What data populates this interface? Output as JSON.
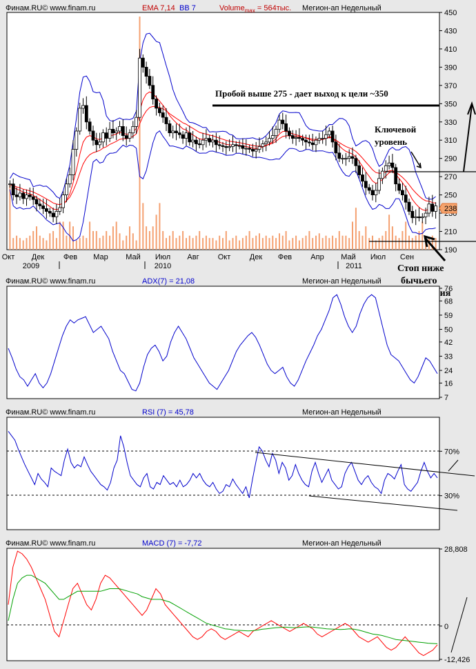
{
  "panels": {
    "price": {
      "header": {
        "source": "Финам.RU© www.finam.ru",
        "ema": "EMA 7,14",
        "bb": "BB 7",
        "volume": "Volume",
        "volume_sub": "max",
        "volume_val": " = 564тыс.",
        "instrument": "Мегион-ап Недельный"
      },
      "y_ticks": [
        "450",
        "430",
        "410",
        "390",
        "370",
        "350",
        "330",
        "310",
        "290",
        "270",
        "250",
        "230",
        "210",
        "190"
      ],
      "y_range": [
        190,
        450
      ],
      "last_price": "238",
      "x_ticks": [
        "Окт",
        "Дек",
        "Фев",
        "Мар",
        "Май",
        "Июл",
        "Авг",
        "Окт",
        "Дек",
        "Фев",
        "Апр",
        "Май",
        "Июл",
        "Сен"
      ],
      "year_labels": [
        "2009",
        "2010",
        "2011"
      ],
      "annotations": {
        "breakout": "Пробой выше 275 - дает выход к цели ~350",
        "key_level_1": "Ключевой",
        "key_level_2": "уровень",
        "stop_1": "Стоп ниже",
        "stop_2": "бычьего",
        "stop_3": "поглощения"
      }
    },
    "adx": {
      "header": {
        "source": "Финам.RU© www.finam.ru",
        "indicator": "ADX(7) = 21,08",
        "instrument": "Мегион-ап Недельный"
      },
      "y_ticks": [
        "76",
        "68",
        "59",
        "50",
        "42",
        "33",
        "24",
        "16",
        "7"
      ],
      "y_range": [
        7,
        76
      ]
    },
    "rsi": {
      "header": {
        "source": "Финам.RU© www.finam.ru",
        "indicator": "RSI (7) = 45,78",
        "instrument": "Мегион-ап Недельный"
      },
      "y_ticks": [
        "70%",
        "30%"
      ],
      "y_range": [
        0,
        100
      ]
    },
    "macd": {
      "header": {
        "source": "Финам.RU© www.finam.ru",
        "indicator": "MACD (7) = -7,72",
        "instrument": "Мегион-ап Недельный"
      },
      "y_ticks": [
        "28,808",
        "0",
        "-12,426"
      ],
      "y_range": [
        -12.426,
        28.808
      ]
    }
  },
  "colors": {
    "candle": "#000000",
    "ema": "#ff0000",
    "bb": "#0000cc",
    "volume": "#f4a070",
    "adx": "#0000cc",
    "rsi": "#0000cc",
    "macd": "#ff0000",
    "signal": "#00a000"
  },
  "chart_data": [
    {
      "type": "candlestick",
      "panel": "price",
      "ylim": [
        190,
        450
      ],
      "x_count": 107,
      "close": [
        262,
        250,
        248,
        252,
        246,
        250,
        248,
        245,
        240,
        238,
        235,
        232,
        230,
        226,
        232,
        236,
        250,
        262,
        272,
        300,
        320,
        345,
        348,
        330,
        320,
        310,
        305,
        308,
        318,
        312,
        322,
        318,
        320,
        325,
        315,
        312,
        318,
        325,
        335,
        400,
        390,
        380,
        370,
        355,
        345,
        340,
        335,
        328,
        318,
        320,
        318,
        316,
        312,
        318,
        308,
        310,
        306,
        305,
        310,
        312,
        308,
        310,
        305,
        304,
        303,
        302,
        303,
        305,
        304,
        304,
        301,
        301,
        300,
        298,
        300,
        303,
        306,
        308,
        312,
        315,
        322,
        332,
        328,
        320,
        315,
        312,
        313,
        312,
        310,
        308,
        307,
        305,
        310,
        312,
        312,
        316,
        320,
        308,
        296,
        290,
        290,
        290,
        292,
        290,
        282,
        272,
        265,
        258,
        255,
        250,
        255,
        268,
        276,
        282,
        285,
        280,
        262,
        255,
        250,
        242,
        232,
        225,
        226,
        225,
        226,
        230,
        240,
        232,
        238
      ],
      "volume": [
        0.28,
        0.05,
        0.06,
        0.05,
        0.04,
        0.05,
        0.06,
        0.08,
        0.1,
        0.06,
        0.05,
        0.04,
        0.07,
        0.08,
        0.05,
        0.12,
        0.12,
        0.06,
        0.12,
        0.1,
        0.04,
        0.05,
        0.06,
        0.05,
        0.12,
        0.08,
        0.08,
        0.05,
        0.06,
        0.08,
        0.06,
        0.1,
        0.12,
        0.07,
        0.04,
        0.06,
        0.1,
        0.07,
        0.04,
        1.0,
        0.2,
        0.1,
        0.08,
        0.1,
        0.15,
        0.2,
        0.08,
        0.05,
        0.06,
        0.08,
        0.05,
        0.06,
        0.08,
        0.05,
        0.06,
        0.05,
        0.06,
        0.08,
        0.05,
        0.06,
        0.05,
        0.05,
        0.04,
        0.06,
        0.05,
        0.08,
        0.04,
        0.05,
        0.06,
        0.04,
        0.05,
        0.06,
        0.08,
        0.05,
        0.06,
        0.07,
        0.05,
        0.06,
        0.05,
        0.06,
        0.05,
        0.07,
        0.06,
        0.08,
        0.04,
        0.05,
        0.06,
        0.04,
        0.05,
        0.06,
        0.08,
        0.05,
        0.06,
        0.07,
        0.05,
        0.06,
        0.05,
        0.06,
        0.05,
        0.08,
        0.06,
        0.06,
        0.05,
        0.12,
        0.18,
        0.08,
        0.06,
        0.1,
        0.05,
        0.06,
        0.04,
        0.05,
        0.06,
        0.08,
        0.15,
        0.1,
        0.06,
        0.05,
        0.08,
        0.12,
        0.06,
        0.05,
        0.06,
        0.08,
        0.12,
        0.04,
        0.05,
        0.06,
        0.05
      ]
    },
    {
      "type": "line",
      "panel": "adx",
      "ylim": [
        7,
        76
      ],
      "y": [
        38,
        32,
        25,
        20,
        18,
        14,
        18,
        22,
        16,
        13,
        16,
        22,
        30,
        38,
        46,
        52,
        56,
        54,
        56,
        57,
        58,
        53,
        48,
        50,
        52,
        48,
        44,
        36,
        30,
        24,
        22,
        17,
        12,
        11,
        16,
        26,
        34,
        38,
        40,
        36,
        30,
        33,
        42,
        48,
        52,
        48,
        44,
        38,
        32,
        28,
        24,
        20,
        16,
        14,
        12,
        16,
        20,
        24,
        30,
        36,
        40,
        43,
        46,
        48,
        45,
        40,
        34,
        28,
        24,
        22,
        24,
        26,
        20,
        16,
        14,
        18,
        24,
        30,
        35,
        40,
        46,
        50,
        56,
        62,
        70,
        72,
        66,
        58,
        52,
        48,
        52,
        60,
        66,
        70,
        72,
        70,
        60,
        50,
        40,
        34,
        32,
        30,
        26,
        22,
        18,
        16,
        20,
        26,
        32,
        30,
        26,
        22
      ]
    },
    {
      "type": "line",
      "panel": "rsi",
      "ylim": [
        0,
        100
      ],
      "y": [
        88,
        84,
        80,
        72,
        65,
        58,
        52,
        46,
        40,
        50,
        45,
        42,
        38,
        55,
        52,
        50,
        48,
        62,
        72,
        60,
        55,
        58,
        56,
        65,
        58,
        52,
        48,
        44,
        40,
        38,
        35,
        42,
        55,
        62,
        84,
        74,
        60,
        48,
        44,
        40,
        38,
        46,
        50,
        38,
        36,
        42,
        40,
        48,
        44,
        40,
        42,
        38,
        44,
        38,
        40,
        44,
        50,
        46,
        50,
        44,
        40,
        38,
        42,
        36,
        32,
        34,
        40,
        38,
        45,
        40,
        36,
        32,
        38,
        28,
        45,
        60,
        74,
        70,
        62,
        56,
        68,
        62,
        50,
        60,
        55,
        44,
        48,
        58,
        50,
        44,
        40,
        38,
        52,
        60,
        50,
        42,
        48,
        54,
        44,
        40,
        36,
        38,
        50,
        56,
        60,
        52,
        44,
        40,
        45,
        48,
        42,
        38,
        36,
        32,
        44,
        50,
        48,
        45,
        52,
        58,
        40,
        36,
        34,
        38,
        42,
        52,
        60,
        52,
        46,
        50,
        46
      ]
    },
    {
      "type": "line",
      "panel": "macd",
      "ylim": [
        -12.426,
        28.808
      ],
      "series": [
        {
          "y": [
            8,
            22,
            28,
            27,
            25,
            22,
            18,
            14,
            10,
            4,
            -2,
            -4,
            2,
            8,
            14,
            16,
            12,
            8,
            6,
            10,
            16,
            19,
            18,
            16,
            14,
            12,
            10,
            8,
            6,
            4,
            6,
            10,
            14,
            12,
            8,
            6,
            4,
            2,
            0,
            -2,
            -4,
            -5,
            -4,
            -2,
            -1,
            -2,
            -4,
            -5,
            -4,
            -3,
            -2,
            -3,
            -4,
            -2,
            -1,
            0,
            1,
            2,
            1,
            0,
            -1,
            -2,
            -1,
            0,
            1,
            0,
            -1,
            -3,
            -4,
            -3,
            -2,
            -1,
            0,
            1,
            0,
            -2,
            -4,
            -5,
            -6,
            -5,
            -4,
            -6,
            -8,
            -9,
            -8,
            -6,
            -4,
            -6,
            -8,
            -10,
            -11,
            -10,
            -9,
            -7
          ]
        },
        {
          "y": [
            2,
            10,
            16,
            18,
            19,
            19,
            18,
            17,
            16,
            14,
            12,
            10,
            10,
            11,
            12,
            13,
            13,
            13,
            13,
            13,
            13,
            13.5,
            14,
            14,
            14,
            13.5,
            13,
            12.5,
            12,
            11,
            10.5,
            10,
            10,
            10,
            9.5,
            9,
            8,
            7,
            6,
            5,
            4,
            3,
            2,
            1,
            0.5,
            0,
            -0.5,
            -1,
            -1.2,
            -1.5,
            -1.6,
            -1.7,
            -1.8,
            -1.7,
            -1.5,
            -1.2,
            -1,
            -0.8,
            -0.6,
            -0.5,
            -0.4,
            -0.5,
            -0.6,
            -0.5,
            -0.4,
            -0.3,
            -0.4,
            -0.6,
            -0.8,
            -1,
            -1.1,
            -1.2,
            -1.3,
            -1.2,
            -1,
            -1.2,
            -1.5,
            -2,
            -2.5,
            -3,
            -3.2,
            -3.5,
            -4,
            -4.5,
            -5,
            -5.2,
            -5.4,
            -5.6,
            -5.8,
            -6,
            -6.2,
            -6.4,
            -6.5,
            -6.6
          ]
        }
      ]
    }
  ]
}
